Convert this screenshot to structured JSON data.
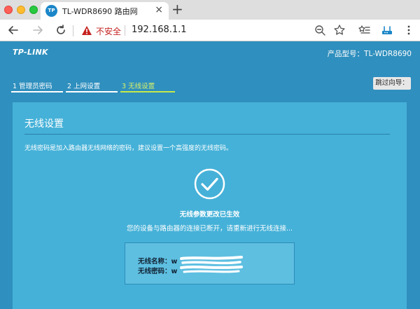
{
  "browser": {
    "tab_title": "TL-WDR8690 路由网",
    "favicon_text": "TP",
    "new_tab": "+",
    "close_tab": "×",
    "insecure_label": "不安全",
    "url": "192.168.1.1",
    "warning_color": "#c5221f"
  },
  "page": {
    "logo": "TP-LINK",
    "model": "产品型号：TL-WDR8690",
    "steps": [
      {
        "label": "1 管理员密码"
      },
      {
        "label": "2 上网设置"
      },
      {
        "label": "3 无线设置"
      }
    ],
    "skip_button": "跳过向导：",
    "panel": {
      "title": "无线设置",
      "description": "无线密码是加入路由器无线网络的密码，建议设置一个高强度的无线密码。",
      "status_title": "无线参数更改已生效",
      "status_subtitle": "您的设备与路由器的连接已断开，请重新进行无线连接...",
      "ssid_label": "无线名称：",
      "password_label": "无线密码：",
      "ssid_value_prefix": "w",
      "password_value_prefix": "w"
    },
    "colors": {
      "background": "#2f8fbe",
      "panel": "#45b1d8",
      "active_step": "#c6e84a"
    }
  }
}
